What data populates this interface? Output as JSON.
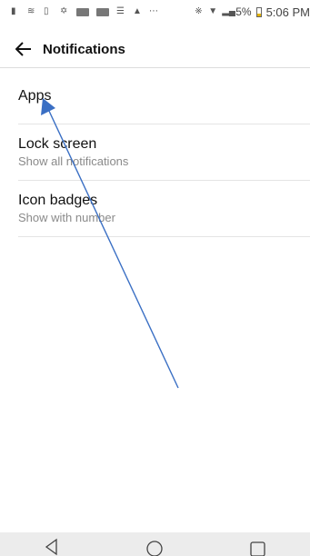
{
  "status_bar": {
    "battery_text": "5%",
    "time": "5:06 PM",
    "overflow_icon": "more-dots-icon"
  },
  "header": {
    "title": "Notifications",
    "back_icon": "arrow-left-icon"
  },
  "settings": [
    {
      "title": "Apps",
      "subtitle": ""
    },
    {
      "title": "Lock screen",
      "subtitle": "Show all notifications"
    },
    {
      "title": "Icon badges",
      "subtitle": "Show with number"
    }
  ],
  "nav_bar": {
    "icons": [
      "back-triangle-icon",
      "home-circle-icon",
      "recents-square-icon"
    ]
  },
  "colors": {
    "annotation_arrow": "#3a6fc4",
    "battery_level": "#e5b400"
  }
}
